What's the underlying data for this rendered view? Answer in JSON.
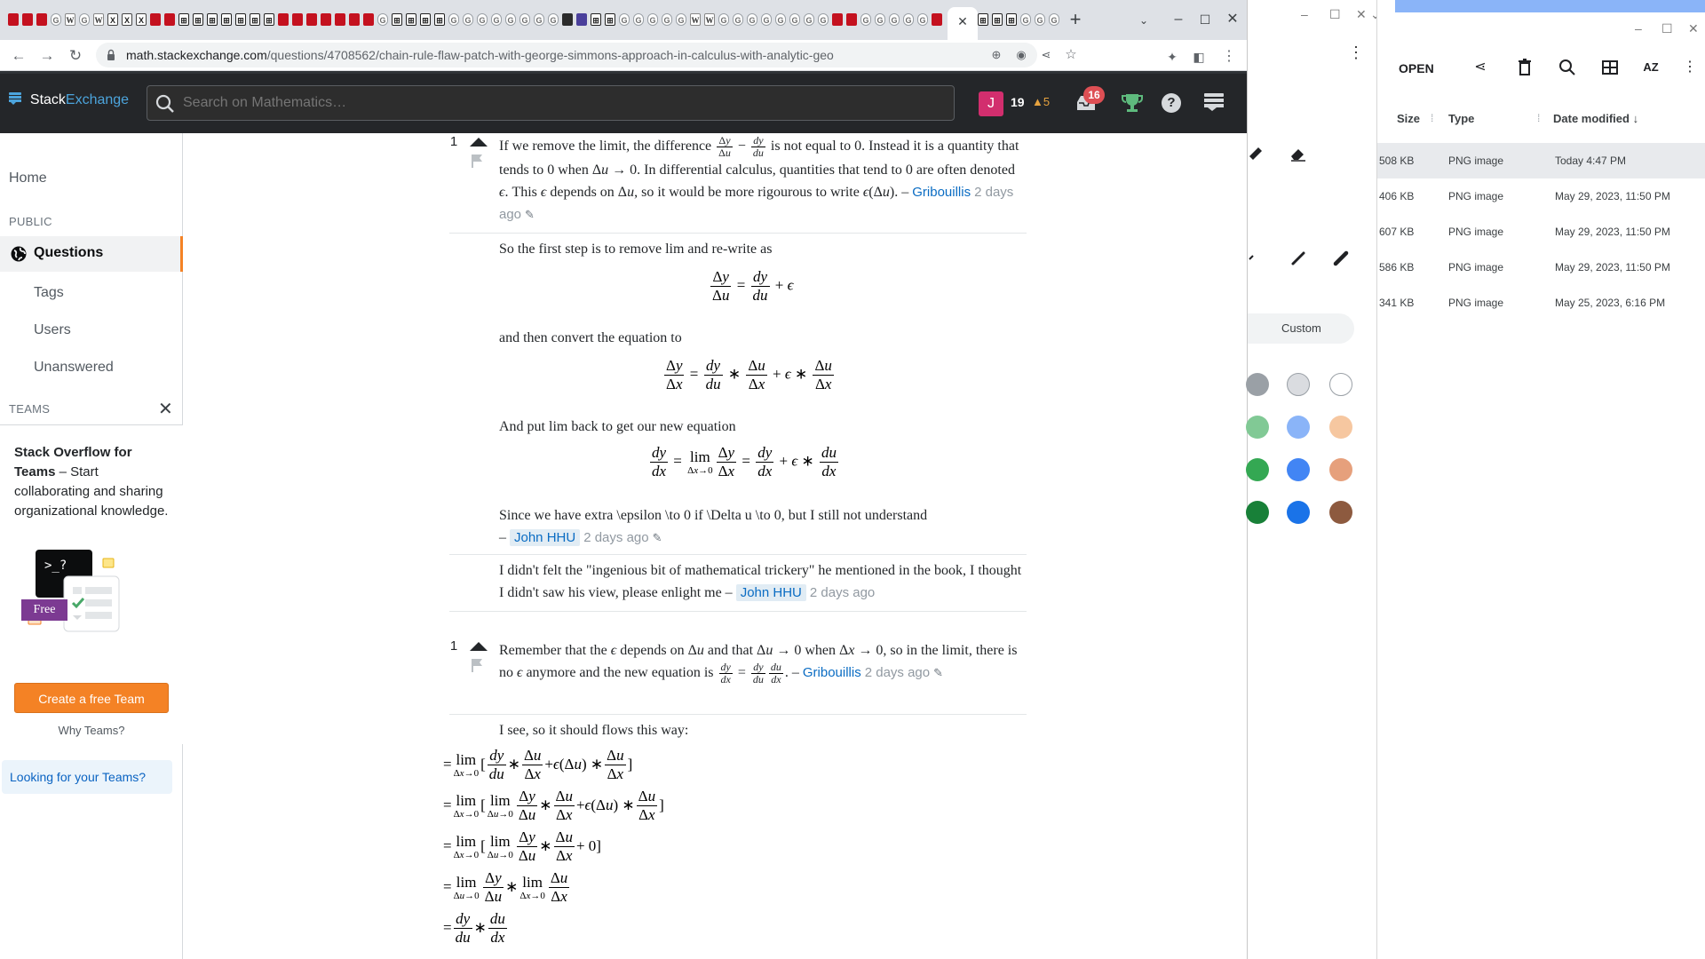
{
  "browser": {
    "active_tab_close": "✕",
    "new_tab": "+",
    "tab_search": "⌄",
    "url_host": "math.stackexchange.com",
    "url_path": "/questions/4708562/chain-rule-flaw-patch-with-george-simmons-approach-in-calculus-with-analytic-geo",
    "controls": {
      "minimize": "–",
      "maximize": "☐",
      "close": "✕"
    }
  },
  "stackexchange": {
    "logo_stack": "Stack",
    "logo_exchange": "Exchange",
    "search_placeholder": "Search on Mathematics…",
    "avatar_letter": "J",
    "reputation": "19",
    "badge_count": "5",
    "inbox_count": "16",
    "help": "?"
  },
  "sidebar": {
    "home": "Home",
    "public_heading": "PUBLIC",
    "questions": "Questions",
    "tags": "Tags",
    "users": "Users",
    "unanswered": "Unanswered",
    "teams_heading": "TEAMS",
    "teams_close": "✕",
    "teams_title": "Stack Overflow for Teams",
    "teams_text": " – Start collaborating and sharing organizational knowledge.",
    "teams_prompt": ">_?",
    "teams_free": "Free",
    "teams_create": "Create a free Team",
    "teams_why": "Why Teams?",
    "teams_looking": "Looking for your Teams?"
  },
  "comments": [
    {
      "score": "1",
      "text_a": "If we remove the limit, the difference ",
      "text_b": " is not equal to 0. Instead it is a quantity that tends to 0 when ",
      "text_c": ". In differential calculus, quantities that tend to 0 are often denoted ",
      "text_d": ". This ",
      "text_e": " depends on ",
      "text_f": ", so it would be more rigourous to write ",
      "text_g": ". – ",
      "user": "Gribouillis",
      "date": "2 days ago"
    },
    {
      "text_a": "So the first step is to remove lim and re-write as",
      "text_b": "and then convert the equation to",
      "text_c": "And put lim back to get our new equation",
      "text_d": "Since we have extra \\epsilon \\to 0 if \\Delta u \\to 0, but I still not understand",
      "dash": "–",
      "user": "John HHU",
      "date": "2 days ago"
    },
    {
      "text": "I didn't felt the \"ingenious bit of mathematical trickery\" he mentioned in the book, I thought I didn't saw his view, please enlight me – ",
      "user": "John HHU",
      "date": "2 days ago"
    },
    {
      "score": "1",
      "text_a": "Remember that the ",
      "text_b": " depends on ",
      "text_c": " and that ",
      "text_d": " when ",
      "text_e": ", so in the limit, there is no ",
      "text_f": " anymore and the new equation is ",
      "text_g": ". – ",
      "user": "Gribouillis",
      "date": "2 days ago"
    },
    {
      "text": "I see, so it should flows this way:"
    }
  ],
  "paint": {
    "menu": "⋮",
    "custom": "Custom",
    "controls": {
      "minimize": "–",
      "maximize": "☐",
      "close": "✕",
      "chevron": "⌄"
    },
    "swatch_colors": [
      "#9aa0a6",
      "#dadce0",
      "#ffffff",
      "#81c995",
      "#8ab4f8",
      "#f6c7a0",
      "#34a853",
      "#4285f4",
      "#e6a07c",
      "#188038",
      "#1a73e8",
      "#8d5a3f"
    ]
  },
  "files": {
    "open": "OPEN",
    "sort_az": "AZ",
    "menu": "⋮",
    "controls": {
      "minimize": "–",
      "maximize": "☐",
      "close": "✕"
    },
    "col_size": "Size",
    "col_type": "Type",
    "col_date": "Date modified",
    "sort_arrow": "↓",
    "rows": [
      {
        "size": "508 KB",
        "type": "PNG image",
        "date": "Today 4:47 PM"
      },
      {
        "size": "406 KB",
        "type": "PNG image",
        "date": "May 29, 2023, 11:50 PM"
      },
      {
        "size": "607 KB",
        "type": "PNG image",
        "date": "May 29, 2023, 11:50 PM"
      },
      {
        "size": "586 KB",
        "type": "PNG image",
        "date": "May 29, 2023, 11:50 PM"
      },
      {
        "size": "341 KB",
        "type": "PNG image",
        "date": "May 25, 2023, 6:16 PM"
      }
    ]
  }
}
